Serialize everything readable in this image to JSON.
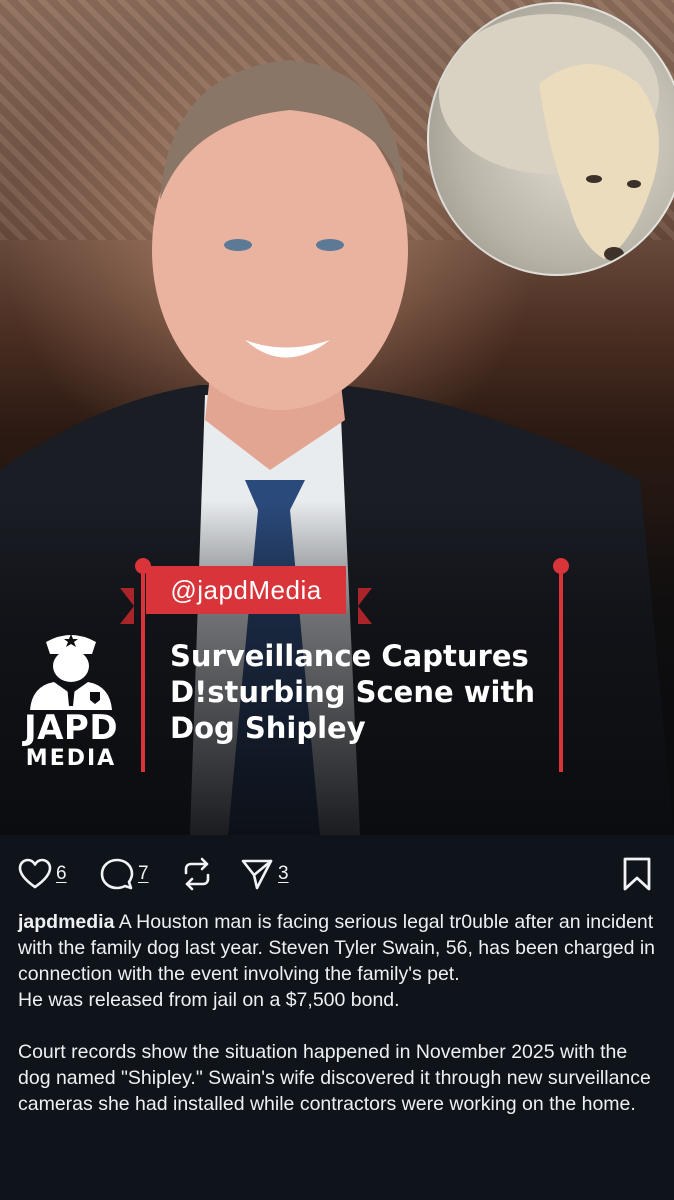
{
  "post": {
    "overlay_handle": "@japdMedia",
    "headline_lines": [
      "Surveillance Captures",
      "D!sturbing Scene with",
      "Dog Shipley"
    ],
    "brand_name": "JAPD",
    "brand_sub": "MEDIA"
  },
  "actions": {
    "likes": "6",
    "comments": "7",
    "shares": "3"
  },
  "caption": {
    "username": "japdmedia",
    "paragraph1": " A Houston man is facing serious legal tr0uble after an incident with the family dog last year. Steven Tyler Swain, 56, has been charged in connection with the event involving the family's pet.",
    "paragraph2": "He was released from jail on a $7,500 bond.",
    "paragraph3": "Court records show the situation happened in November 2025 with the dog named \"Shipley.\" Swain's wife discovered it through new surveillance cameras she had installed while contractors were working on the home."
  },
  "colors": {
    "accent_red": "#d8343a",
    "background": "#0f131a",
    "text": "#f2f3f5"
  },
  "icons": [
    "heart-icon",
    "comment-icon",
    "repost-icon",
    "send-icon",
    "bookmark-icon",
    "police-officer-icon"
  ]
}
